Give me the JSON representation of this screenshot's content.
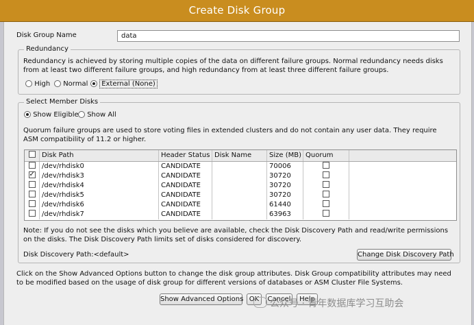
{
  "window": {
    "title": "Create Disk Group"
  },
  "disk_group_name": {
    "label": "Disk Group Name",
    "value": "data"
  },
  "redundancy": {
    "legend": "Redundancy",
    "description": "Redundancy is achieved by storing multiple copies of the data on different failure groups. Normal redundancy needs disks from at least two different failure groups, and high redundancy from at least three different failure groups.",
    "options": [
      {
        "label": "High",
        "selected": false
      },
      {
        "label": "Normal",
        "selected": false
      },
      {
        "label": "External (None)",
        "selected": true
      }
    ]
  },
  "member_disks": {
    "legend": "Select Member Disks",
    "filters": [
      {
        "label": "Show Eligible",
        "selected": true
      },
      {
        "label": "Show All",
        "selected": false
      }
    ],
    "quorum_note": "Quorum failure groups are used to store voting files in extended clusters and do not contain any user data. They require ASM compatibility of 11.2 or higher.",
    "table": {
      "headers": [
        "Disk Path",
        "Header Status",
        "Disk Name",
        "Size (MB)",
        "Quorum"
      ],
      "rows": [
        {
          "checked": false,
          "path": "/dev/rhdisk0",
          "status": "CANDIDATE",
          "name": "",
          "size": "70006",
          "quorum": false
        },
        {
          "checked": true,
          "path": "/dev/rhdisk3",
          "status": "CANDIDATE",
          "name": "",
          "size": "30720",
          "quorum": false
        },
        {
          "checked": false,
          "path": "/dev/rhdisk4",
          "status": "CANDIDATE",
          "name": "",
          "size": "30720",
          "quorum": false
        },
        {
          "checked": false,
          "path": "/dev/rhdisk5",
          "status": "CANDIDATE",
          "name": "",
          "size": "30720",
          "quorum": false
        },
        {
          "checked": false,
          "path": "/dev/rhdisk6",
          "status": "CANDIDATE",
          "name": "",
          "size": "61440",
          "quorum": false
        },
        {
          "checked": false,
          "path": "/dev/rhdisk7",
          "status": "CANDIDATE",
          "name": "",
          "size": "63963",
          "quorum": false
        }
      ]
    },
    "note": "Note: If you do not see the disks which you believe are available, check the Disk Discovery Path and read/write permissions on the disks. The Disk Discovery Path limits set of disks considered for discovery.",
    "discovery_path": "Disk Discovery Path:<default>",
    "change_path_button": "Change Disk Discovery Path"
  },
  "footer_note": "Click on the Show Advanced Options button to change the disk group attributes. Disk Group compatibility attributes may need to be modified based on the usage of disk group for different versions of databases or ASM Cluster File Systems.",
  "buttons": {
    "advanced": "Show Advanced Options",
    "ok": "OK",
    "cancel": "Cancel",
    "help": "Help"
  },
  "watermark": "公众号 · 青年数据库学习互助会"
}
